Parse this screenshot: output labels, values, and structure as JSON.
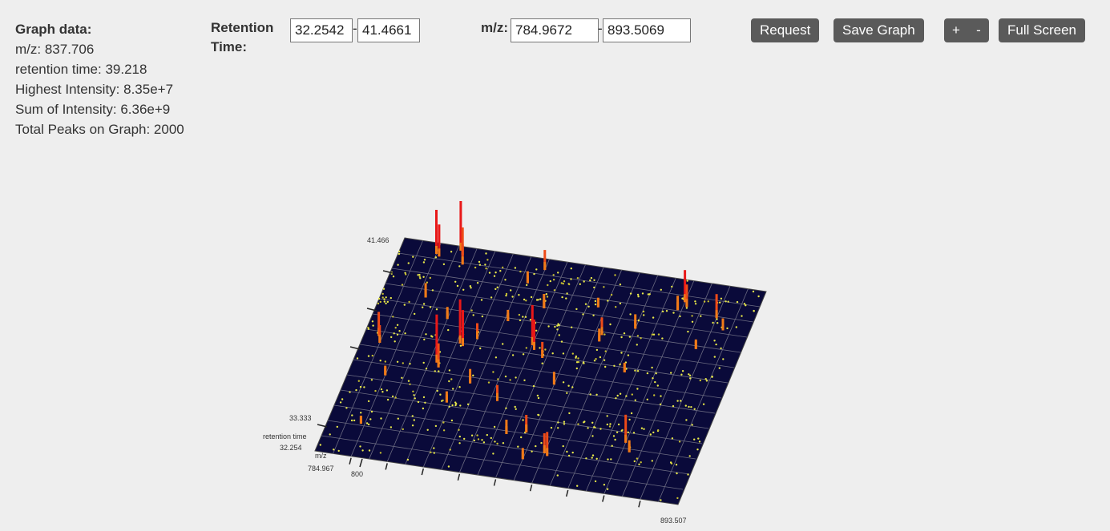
{
  "graph_data": {
    "title": "Graph data:",
    "mz": "m/z: 837.706",
    "retention_time": "retention time: 39.218",
    "highest_intensity": "Highest Intensity: 8.35e+7",
    "sum_intensity": "Sum of Intensity: 6.36e+9",
    "total_peaks": "Total Peaks on Graph: 2000"
  },
  "controls": {
    "rt_label_line1": "Retention",
    "rt_label_line2": "Time:",
    "rt_min": "32.2542",
    "rt_max": "41.4661",
    "range_dash": "-",
    "mz_label": "m/z:",
    "mz_min": "784.9672",
    "mz_max": "893.5069",
    "request_label": "Request",
    "save_label": "Save Graph",
    "zoom_in_label": "+",
    "zoom_out_label": "-",
    "fullscreen_label": "Full Screen"
  },
  "plot": {
    "rt_top_label": "41.466",
    "rt_tick_label": "33.333",
    "rt_axis_title": "retention time",
    "rt_bottom_label": "32.254",
    "mz_axis_title": "m/z",
    "mz_min_label": "784.967",
    "mz_tick_label": "800",
    "mz_max_label": "893.507",
    "colors": {
      "plane": "#0a0a3a",
      "grid": "#6a6a80",
      "low": "#e8e84a",
      "mid": "#f07a18",
      "high": "#e81818"
    }
  }
}
